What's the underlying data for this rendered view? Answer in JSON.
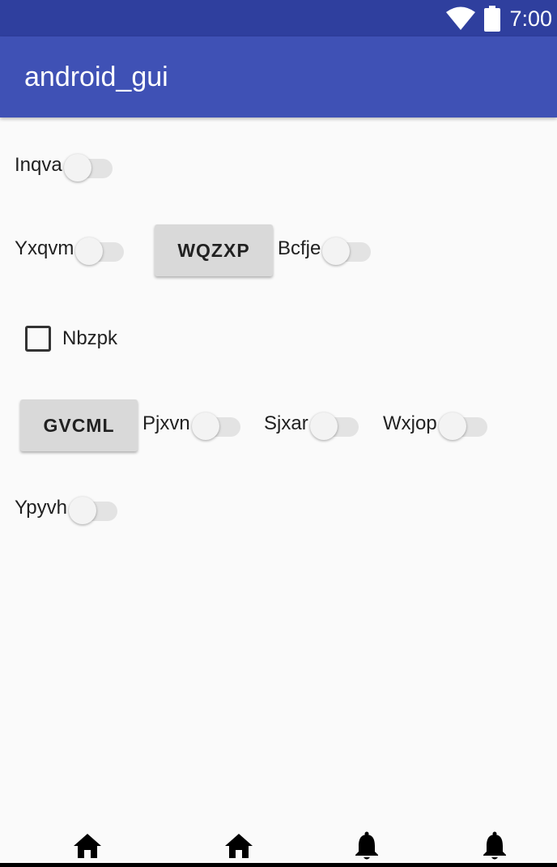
{
  "status_bar": {
    "time": "7:00"
  },
  "app_bar": {
    "title": "android_gui"
  },
  "rows": {
    "r1": {
      "switch_label": "Inqva"
    },
    "r2": {
      "switch1_label": "Yxqvm",
      "button_label": "WQZXP",
      "switch2_label": "Bcfje"
    },
    "r3": {
      "checkbox_label": "Nbzpk"
    },
    "r4": {
      "button_label": "GVCML",
      "switch1_label": "Pjxvn",
      "switch2_label": "Sjxar",
      "switch3_label": "Wxjop"
    },
    "r5": {
      "switch_label": "Ypyvh"
    }
  },
  "bottom_nav": {
    "items": [
      {
        "icon": "home-icon"
      },
      {
        "icon": "home-icon"
      },
      {
        "icon": "bell-icon"
      },
      {
        "icon": "bell-icon"
      }
    ]
  },
  "colors": {
    "status_bar": "#2f3f9e",
    "app_bar": "#3f51b5",
    "background": "#fafafa",
    "button": "#d9d9d9"
  }
}
